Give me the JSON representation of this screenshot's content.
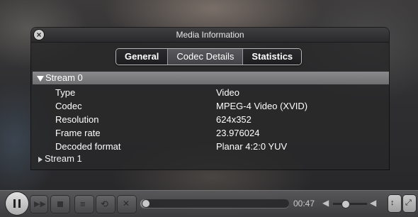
{
  "window": {
    "title": "Media Information",
    "close_glyph": "×"
  },
  "tabs": [
    {
      "label": "General",
      "active": false
    },
    {
      "label": "Codec Details",
      "active": true
    },
    {
      "label": "Statistics",
      "active": false
    }
  ],
  "streams": [
    {
      "label": "Stream 0",
      "expanded": true,
      "properties": [
        {
          "key": "Type",
          "value": "Video"
        },
        {
          "key": "Codec",
          "value": "MPEG-4 Video (XVID)"
        },
        {
          "key": "Resolution",
          "value": "624x352"
        },
        {
          "key": "Frame rate",
          "value": "23.976024"
        },
        {
          "key": "Decoded format",
          "value": "Planar 4:2:0 YUV"
        }
      ]
    },
    {
      "label": "Stream 1",
      "expanded": false
    }
  ],
  "controller": {
    "time": "00:47",
    "progress_fraction": 0.01,
    "volume_fraction": 0.35,
    "icons": [
      "pause-icon",
      "fast-forward-icon",
      "stop-icon",
      "playlist-icon",
      "repeat-icon",
      "shuffle-icon",
      "volume-icon",
      "equalizer-icon",
      "fullscreen-icon"
    ]
  },
  "colors": {
    "selected_stream_bg": "#7d7d80",
    "panel_bg": "#28282a"
  }
}
